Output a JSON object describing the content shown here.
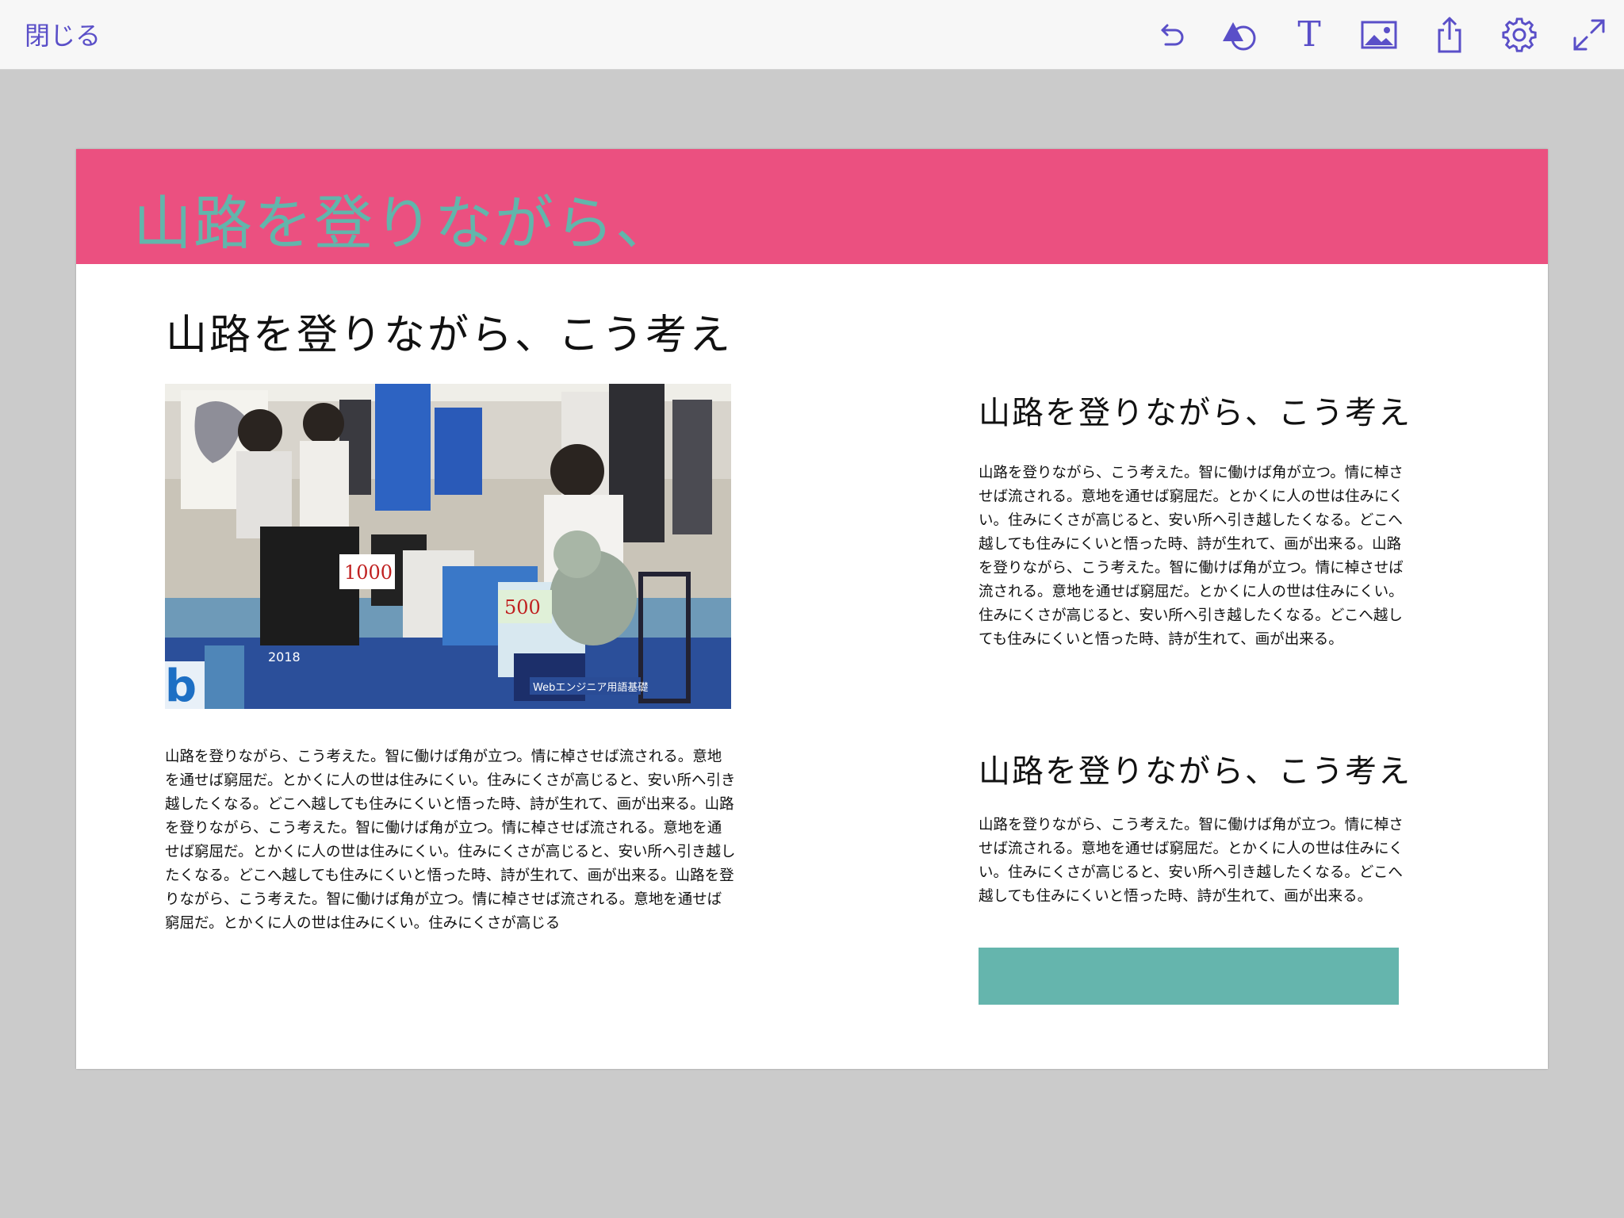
{
  "toolbar": {
    "close_label": "閉じる",
    "tools": [
      "undo-icon",
      "shapes-icon",
      "text-icon",
      "image-icon",
      "share-icon",
      "gear-icon",
      "fullscreen-icon"
    ],
    "text_tool_glyph": "T",
    "accent_color": "#5a4fc8"
  },
  "page": {
    "banner_color": "#eb5080",
    "banner_title": "山路を登りながら、",
    "left_heading": "山路を登りながら、こう考え",
    "left_body": "山路を登りながら、こう考えた。智に働けば角が立つ。情に棹させば流される。意地を通せば窮屈だ。とかくに人の世は住みにくい。住みにくさが高じると、安い所へ引き越したくなる。どこへ越しても住みにくいと悟った時、詩が生れて、画が出来る。山路を登りながら、こう考えた。智に働けば角が立つ。情に棹させば流される。意地を通せば窮屈だ。とかくに人の世は住みにくい。住みにくさが高じると、安い所へ引き越したくなる。どこへ越しても住みにくいと悟った時、詩が生れて、画が出来る。山路を登りながら、こう考えた。智に働けば角が立つ。情に棹させば流される。意地を通せば窮屈だ。とかくに人の世は住みにくい。住みにくさが高じる",
    "right_heading_1": "山路を登りながら、こう考え",
    "right_body_1": "山路を登りながら、こう考えた。智に働けば角が立つ。情に棹させば流される。意地を通せば窮屈だ。とかくに人の世は住みにくい。住みにくさが高じると、安い所へ引き越したくなる。どこへ越しても住みにくいと悟った時、詩が生れて、画が出来る。山路を登りながら、こう考えた。智に働けば角が立つ。情に棹させば流される。意地を通せば窮屈だ。とかくに人の世は住みにくい。住みにくさが高じると、安い所へ引き越したくなる。どこへ越しても住みにくいと悟った時、詩が生れて、画が出来る。",
    "right_heading_2": "山路を登りながら、こう考え",
    "right_body_2": "山路を登りながら、こう考えた。智に働けば角が立つ。情に棹させば流される。意地を通せば窮屈だ。とかくに人の世は住みにくい。住みにくさが高じると、安い所へ引き越したくなる。どこへ越しても住みにくいと悟った時、詩が生れて、画が出来る。",
    "teal_color": "#65b5ad",
    "photo_signs": [
      "1000",
      "500",
      "Webエンジニア用語基礎",
      "2018",
      "b"
    ]
  }
}
